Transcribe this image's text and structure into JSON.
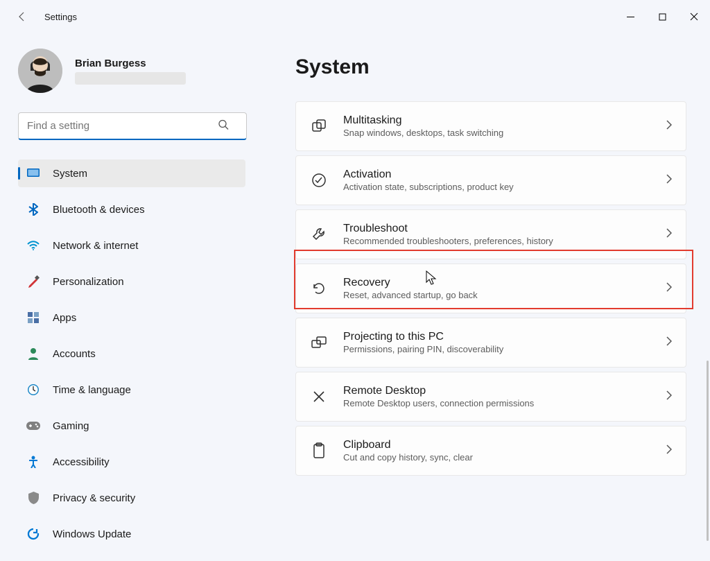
{
  "window": {
    "title": "Settings"
  },
  "profile": {
    "name": "Brian Burgess"
  },
  "search": {
    "placeholder": "Find a setting"
  },
  "sidebar": [
    {
      "id": "system",
      "label": "System",
      "icon": "display",
      "color": "#0067c0",
      "selected": true
    },
    {
      "id": "bluetooth",
      "label": "Bluetooth & devices",
      "icon": "bluetooth",
      "color": "#0067c0"
    },
    {
      "id": "network",
      "label": "Network & internet",
      "icon": "wifi",
      "color": "#0093d0"
    },
    {
      "id": "personalization",
      "label": "Personalization",
      "icon": "brush",
      "color": "#d13438"
    },
    {
      "id": "apps",
      "label": "Apps",
      "icon": "grid",
      "color": "#4a6fa5"
    },
    {
      "id": "accounts",
      "label": "Accounts",
      "icon": "person",
      "color": "#2c8a5a"
    },
    {
      "id": "time",
      "label": "Time & language",
      "icon": "clock",
      "color": "#1e88c7"
    },
    {
      "id": "gaming",
      "label": "Gaming",
      "icon": "gamepad",
      "color": "#808080"
    },
    {
      "id": "accessibility",
      "label": "Accessibility",
      "icon": "access",
      "color": "#0078d4"
    },
    {
      "id": "privacy",
      "label": "Privacy & security",
      "icon": "shield",
      "color": "#8a8a8a"
    },
    {
      "id": "update",
      "label": "Windows Update",
      "icon": "update",
      "color": "#0078d4"
    }
  ],
  "page": {
    "title": "System"
  },
  "cards": [
    {
      "id": "multitasking",
      "title": "Multitasking",
      "sub": "Snap windows, desktops, task switching",
      "icon": "multitask"
    },
    {
      "id": "activation",
      "title": "Activation",
      "sub": "Activation state, subscriptions, product key",
      "icon": "check"
    },
    {
      "id": "troubleshoot",
      "title": "Troubleshoot",
      "sub": "Recommended troubleshooters, preferences, history",
      "icon": "wrench",
      "highlighted": true
    },
    {
      "id": "recovery",
      "title": "Recovery",
      "sub": "Reset, advanced startup, go back",
      "icon": "recovery"
    },
    {
      "id": "projecting",
      "title": "Projecting to this PC",
      "sub": "Permissions, pairing PIN, discoverability",
      "icon": "project"
    },
    {
      "id": "remotedesktop",
      "title": "Remote Desktop",
      "sub": "Remote Desktop users, connection permissions",
      "icon": "remote"
    },
    {
      "id": "clipboard",
      "title": "Clipboard",
      "sub": "Cut and copy history, sync, clear",
      "icon": "clipboard"
    }
  ]
}
